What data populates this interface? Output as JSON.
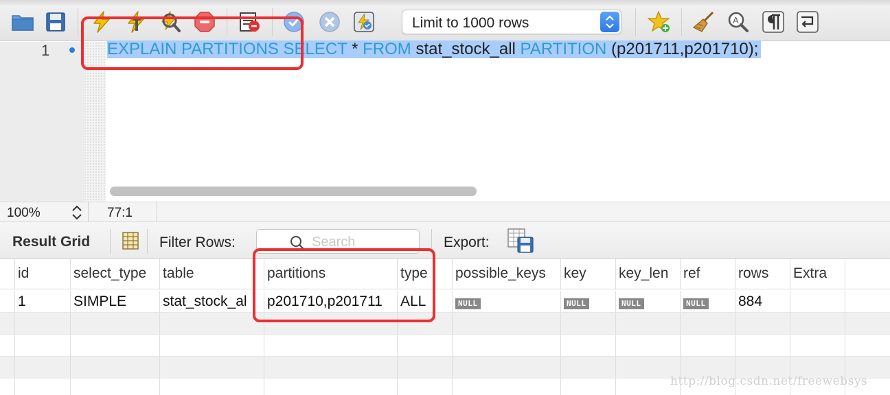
{
  "toolbar": {
    "buttons": [
      {
        "name": "open-file-icon",
        "color": "#4a86c8"
      },
      {
        "name": "save-icon",
        "color": "#3b6fb1"
      },
      {
        "name": "execute-lightning-icon",
        "color": "#f0b400"
      },
      {
        "name": "execute-current-lightning-icon",
        "color": "#f0b400"
      },
      {
        "name": "explain-magnifier-icon",
        "color": "#f0b400"
      },
      {
        "name": "stop-icon",
        "color": "#e05050"
      },
      {
        "name": "toggle-continue-on-error-icon",
        "color": "#e03030"
      },
      {
        "name": "commit-icon",
        "color": "#7aa7e8"
      },
      {
        "name": "rollback-icon",
        "color": "#9ab2d6"
      },
      {
        "name": "autocommit-icon",
        "color": "#6b8fc7"
      },
      {
        "name": "add-snippet-star-icon",
        "color": "#f3c21d"
      },
      {
        "name": "beautify-broom-icon",
        "color": "#b07a2a"
      },
      {
        "name": "find-replace-icon",
        "color": "#555555"
      },
      {
        "name": "invisible-characters-icon",
        "color": "#333333"
      },
      {
        "name": "wrap-lines-icon",
        "color": "#333333"
      }
    ],
    "limit_select": {
      "value": "Limit to 1000 rows"
    }
  },
  "editor": {
    "line_number": "1",
    "sql_tokens": [
      {
        "text": "EXPLAIN PARTITIONS SELECT",
        "kind": "keyword"
      },
      {
        "text": " * ",
        "kind": "ident"
      },
      {
        "text": "FROM",
        "kind": "keyword"
      },
      {
        "text": " stat_stock_all ",
        "kind": "ident"
      },
      {
        "text": "PARTITION",
        "kind": "keyword"
      },
      {
        "text": " (p201711,p201710);",
        "kind": "ident"
      }
    ]
  },
  "status": {
    "zoom": "100%",
    "cursor_pos": "77:1"
  },
  "result": {
    "title": "Result Grid",
    "filter_label": "Filter Rows:",
    "search_placeholder": "Search",
    "export_label": "Export:"
  },
  "grid": {
    "columns": [
      "id",
      "select_type",
      "table",
      "partitions",
      "type",
      "possible_keys",
      "key",
      "key_len",
      "ref",
      "rows",
      "Extra"
    ],
    "rows": [
      [
        "1",
        "SIMPLE",
        "stat_stock_al",
        "p201710,p201711",
        "ALL",
        "NULL",
        "NULL",
        "NULL",
        "NULL",
        "884",
        ""
      ]
    ],
    "empty_row_count": 4
  },
  "watermark": "http://blog.csdn.net/freewebsys",
  "colors": {
    "keyword": "#2e9bd6",
    "selection": "#a9cdfb",
    "annotation": "#ec2f2f"
  }
}
